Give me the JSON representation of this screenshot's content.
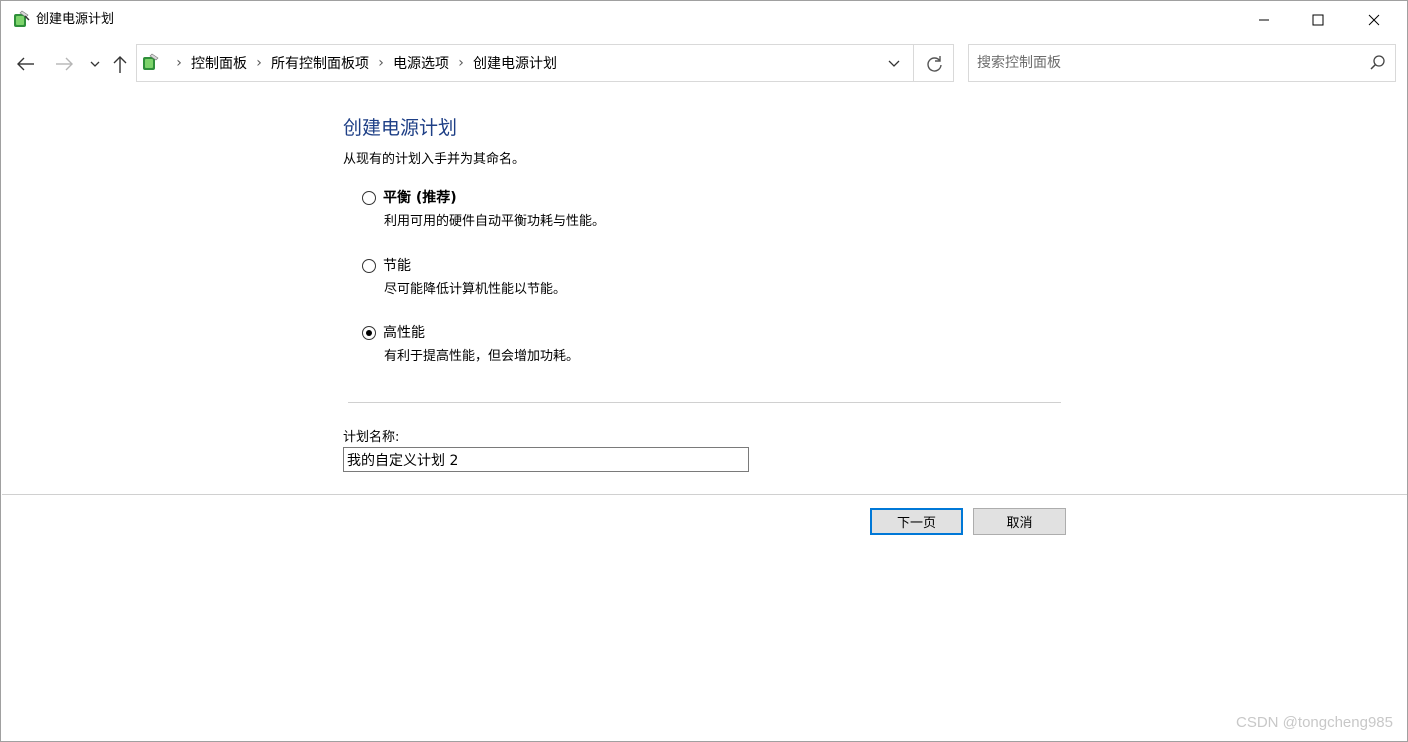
{
  "window": {
    "title": "创建电源计划"
  },
  "addressbar": {
    "breadcrumbs": [
      "控制面板",
      "所有控制面板项",
      "电源选项",
      "创建电源计划"
    ]
  },
  "search": {
    "placeholder": "搜索控制面板"
  },
  "main": {
    "title": "创建电源计划",
    "description": "从现有的计划入手并为其命名。",
    "options": [
      {
        "label": "平衡 (推荐)",
        "description": "利用可用的硬件自动平衡功耗与性能。",
        "selected": false
      },
      {
        "label": "节能",
        "description": "尽可能降低计算机性能以节能。",
        "selected": false
      },
      {
        "label": "高性能",
        "description": "有利于提高性能，但会增加功耗。",
        "selected": true
      }
    ],
    "plan_name_label": "计划名称:",
    "plan_name_value": "我的自定义计划 2"
  },
  "buttons": {
    "next_label": "下一页",
    "cancel_label": "取消"
  },
  "watermark": "CSDN @tongcheng985",
  "icons": {
    "app": "power-options-icon",
    "back": "arrow-left-icon",
    "forward": "arrow-right-icon",
    "history": "chevron-down-icon",
    "up": "arrow-up-icon",
    "refresh": "refresh-icon",
    "search": "search-icon"
  },
  "colors": {
    "title": "#1e3f86",
    "focus_border": "#0078d7"
  }
}
